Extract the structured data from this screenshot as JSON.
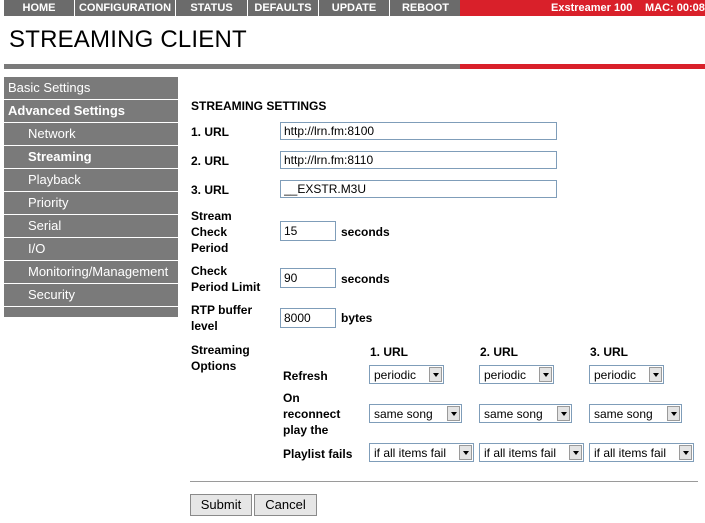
{
  "top_nav": {
    "items": [
      "HOME",
      "CONFIGURATION",
      "STATUS",
      "DEFAULTS",
      "UPDATE",
      "REBOOT"
    ],
    "device": "Exstreamer 100",
    "mac": "MAC: 00:08"
  },
  "page_title": "STREAMING CLIENT",
  "sidebar": {
    "items": [
      {
        "label": "Basic Settings"
      },
      {
        "label": "Advanced Settings"
      },
      {
        "label": "Network"
      },
      {
        "label": "Streaming"
      },
      {
        "label": "Playback"
      },
      {
        "label": "Priority"
      },
      {
        "label": "Serial"
      },
      {
        "label": "I/O"
      },
      {
        "label": "Monitoring/Management"
      },
      {
        "label": "Security"
      }
    ]
  },
  "form": {
    "section_title": "STREAMING SETTINGS",
    "url1": {
      "label": "1. URL",
      "value": "http://lrn.fm:8100"
    },
    "url2": {
      "label": "2. URL",
      "value": "http://lrn.fm:8110"
    },
    "url3": {
      "label": "3. URL",
      "value": "__EXSTR.M3U"
    },
    "stream_check": {
      "label_lines": [
        "Stream",
        "Check",
        "Period"
      ],
      "value": "15",
      "unit": "seconds"
    },
    "check_limit": {
      "label_lines": [
        "Check",
        "Period Limit"
      ],
      "value": "90",
      "unit": "seconds"
    },
    "rtp_buffer": {
      "label_lines": [
        "RTP buffer",
        "level"
      ],
      "value": "8000",
      "unit": "bytes"
    },
    "streaming_options": {
      "label_lines": [
        "Streaming",
        "Options"
      ],
      "columns": [
        "1. URL",
        "2. URL",
        "3. URL"
      ],
      "refresh": {
        "label": "Refresh",
        "values": [
          "periodic",
          "periodic",
          "periodic"
        ]
      },
      "reconnect": {
        "label_lines": [
          "On",
          "reconnect",
          "play the"
        ],
        "values": [
          "same song",
          "same song",
          "same song"
        ]
      },
      "playlist": {
        "label": "Playlist fails",
        "values": [
          "if all items fail",
          "if all items fail",
          "if all items fail"
        ]
      }
    },
    "submit_label": "Submit",
    "cancel_label": "Cancel"
  }
}
